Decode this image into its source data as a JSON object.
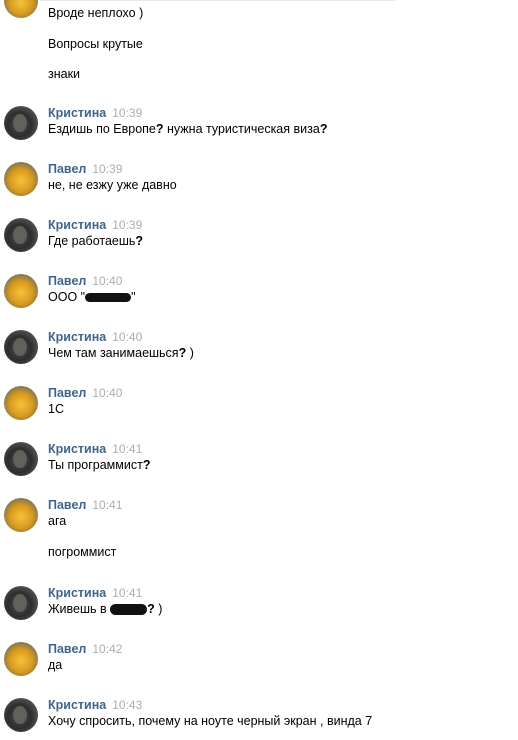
{
  "messages": [
    {
      "lines": [
        "Вроде неплохо )",
        "Вопросы крутые",
        "знаки"
      ]
    },
    {
      "author": "Кристина",
      "time": "10:39",
      "lines": [
        "Ездишь по Европе",
        "?",
        " нужна туристическая виза",
        "?"
      ]
    },
    {
      "author": "Павел",
      "time": "10:39",
      "lines": [
        "не, не езжу уже давно"
      ]
    },
    {
      "author": "Кристина",
      "time": "10:39",
      "lines": [
        "Где работаешь",
        "?"
      ]
    },
    {
      "author": "Павел",
      "time": "10:40",
      "lines": [
        "ООО \"",
        "\""
      ]
    },
    {
      "author": "Кристина",
      "time": "10:40",
      "lines": [
        "Чем там занимаешься",
        "?",
        " )"
      ]
    },
    {
      "author": "Павел",
      "time": "10:40",
      "lines": [
        "1С"
      ]
    },
    {
      "author": "Кристина",
      "time": "10:41",
      "lines": [
        "Ты программист",
        "?"
      ]
    },
    {
      "author": "Павел",
      "time": "10:41",
      "lines": [
        "ага",
        "погроммист"
      ]
    },
    {
      "author": "Кристина",
      "time": "10:41",
      "lines": [
        "Живешь в ",
        "?",
        " )"
      ]
    },
    {
      "author": "Павел",
      "time": "10:42",
      "lines": [
        "да"
      ]
    },
    {
      "author": "Кристина",
      "time": "10:43",
      "lines": [
        "Хочу спросить, почему на ноуте черный экран , винда 7"
      ]
    }
  ]
}
